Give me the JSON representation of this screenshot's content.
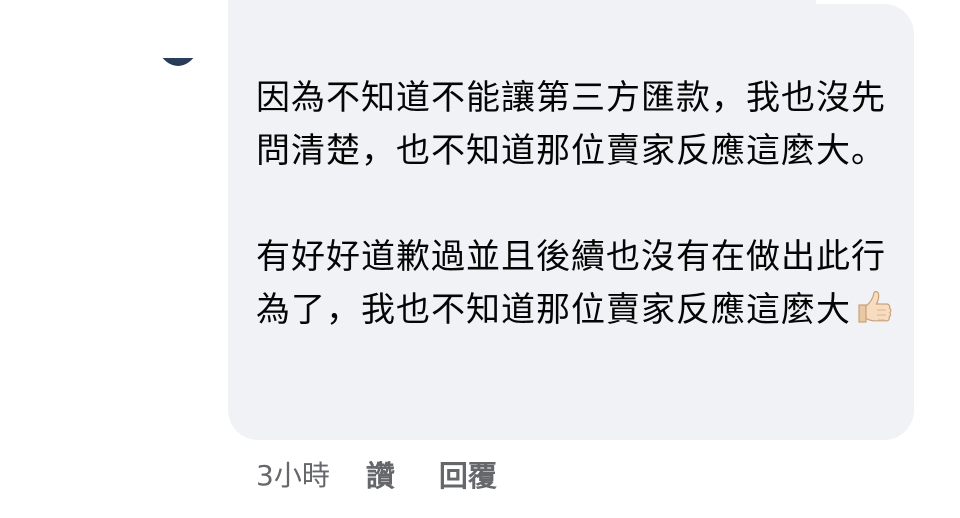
{
  "comment": {
    "paragraphs": [
      "因為不知道不能讓第三方匯款，我也沒先問清楚，也不知道那位賣家反應這麼大。",
      "有好好道歉過並且後續也沒有在做出此行為了，我也不知道那位賣家反應這麼大"
    ],
    "trailing_emoji": "thumbs-up-icon"
  },
  "actions": {
    "time": "3小時",
    "like_label": "讚",
    "reply_label": "回覆"
  },
  "colors": {
    "bubble_bg": "#f0f2f5",
    "text": "#050505",
    "meta_text": "#65676b"
  }
}
